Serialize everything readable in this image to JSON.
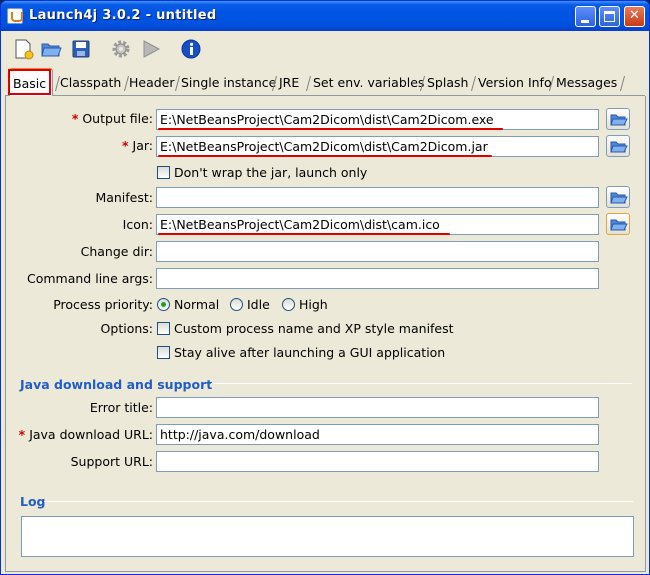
{
  "window": {
    "title": "Launch4j 3.0.2 - untitled",
    "controls": [
      "minimize-icon",
      "maximize-icon",
      "close-icon"
    ]
  },
  "toolbar": {
    "icons": [
      "new-file-icon",
      "open-folder-icon",
      "save-icon",
      "settings-gear-icon",
      "run-play-icon",
      "info-icon"
    ]
  },
  "tabs": [
    {
      "label": "Basic",
      "active": true
    },
    {
      "label": "Classpath"
    },
    {
      "label": "Header"
    },
    {
      "label": "Single instance"
    },
    {
      "label": "JRE"
    },
    {
      "label": "Set env. variables"
    },
    {
      "label": "Splash"
    },
    {
      "label": "Version Info"
    },
    {
      "label": "Messages"
    }
  ],
  "basic": {
    "output_file": {
      "label": "Output file:",
      "required_mark": "*",
      "value": "E:\\NetBeansProject\\Cam2Dicom\\dist\\Cam2Dicom.exe"
    },
    "jar": {
      "label": "Jar:",
      "required_mark": "*",
      "value": "E:\\NetBeansProject\\Cam2Dicom\\dist\\Cam2Dicom.jar"
    },
    "dont_wrap": {
      "label": "Don't wrap the jar, launch only",
      "checked": false
    },
    "manifest": {
      "label": "Manifest:",
      "value": ""
    },
    "icon": {
      "label": "Icon:",
      "value": "E:\\NetBeansProject\\Cam2Dicom\\dist\\cam.ico"
    },
    "change_dir": {
      "label": "Change dir:",
      "value": ""
    },
    "cmd_args": {
      "label": "Command line args:",
      "value": ""
    },
    "priority": {
      "label": "Process priority:",
      "options": [
        {
          "label": "Normal",
          "selected": true
        },
        {
          "label": "Idle",
          "selected": false
        },
        {
          "label": "High",
          "selected": false
        }
      ]
    },
    "options": {
      "label": "Options:",
      "custom_process": {
        "label": "Custom process name and XP style manifest",
        "checked": false
      },
      "stay_alive": {
        "label": "Stay alive after launching a GUI application",
        "checked": false
      }
    }
  },
  "java_download": {
    "title": "Java download and support",
    "error_title": {
      "label": "Error title:",
      "value": ""
    },
    "download_url": {
      "label": "Java download URL:",
      "required_mark": "*",
      "value": "http://java.com/download"
    },
    "support_url": {
      "label": "Support URL:",
      "value": ""
    }
  },
  "log": {
    "title": "Log"
  },
  "colors": {
    "titlebar": "#0054e3",
    "section_title": "#215dc6",
    "highlight": "#e00000",
    "required": "#cc0000"
  }
}
